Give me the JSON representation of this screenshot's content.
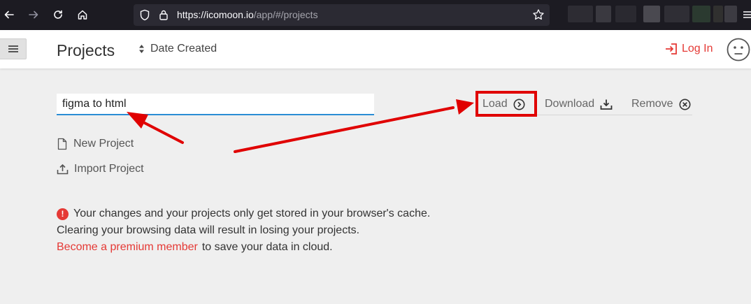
{
  "browser": {
    "url_host": "https://icomoon.io",
    "url_path": "/app/#/projects"
  },
  "header": {
    "title": "Projects",
    "sort_label": "Date Created",
    "login_label": "Log In"
  },
  "project": {
    "name_value": "figma to html",
    "actions": [
      {
        "label": "Load",
        "icon": "chevron-right-circle-icon"
      },
      {
        "label": "Download",
        "icon": "download-icon"
      },
      {
        "label": "Remove",
        "icon": "close-circle-icon"
      }
    ]
  },
  "menu": {
    "new_project": "New Project",
    "import_project": "Import Project"
  },
  "notice": {
    "line1": "Your changes and your projects only get stored in your browser's cache.",
    "line2": "Clearing your browsing data will result in losing your projects.",
    "premium_link": "Become a premium member",
    "line3_rest": "to save your data in cloud."
  },
  "colors": {
    "accent_red": "#e53935",
    "input_underline": "#2a8dd4",
    "highlight_box": "#e00000",
    "browser_chrome": "#1c1b22"
  }
}
